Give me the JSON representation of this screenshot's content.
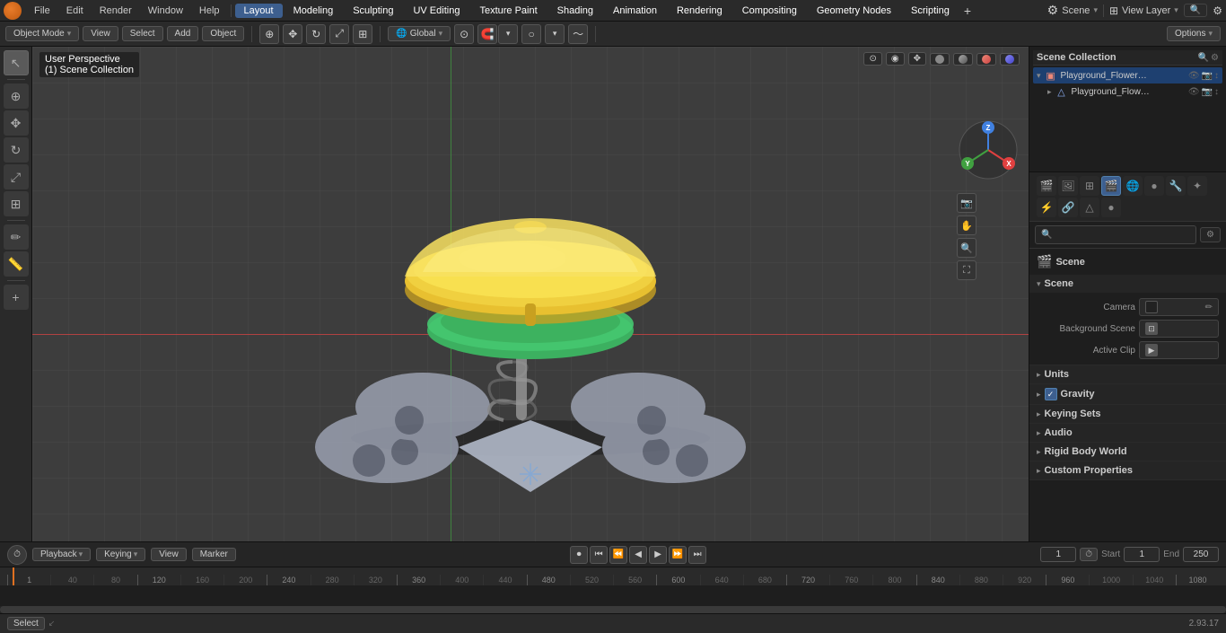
{
  "app": {
    "title": "Blender",
    "version": "2.93.17"
  },
  "top_menu": {
    "items": [
      "File",
      "Edit",
      "Render",
      "Window",
      "Help"
    ],
    "workspaces": [
      "Layout",
      "Modeling",
      "Sculpting",
      "UV Editing",
      "Texture Paint",
      "Shading",
      "Animation",
      "Rendering",
      "Compositing",
      "Geometry Nodes",
      "Scripting"
    ],
    "active_workspace": "Layout",
    "scene_label": "Scene",
    "view_layer_label": "View Layer"
  },
  "toolbar": {
    "mode_label": "Object Mode",
    "view_label": "View",
    "select_label": "Select",
    "add_label": "Add",
    "object_label": "Object",
    "global_label": "Global",
    "options_label": "Options"
  },
  "outliner": {
    "title": "Scene Collection",
    "items": [
      {
        "name": "Playground_Flower_Springer...",
        "indent": 0,
        "expanded": true
      },
      {
        "name": "Playground_Flower_Sprir",
        "indent": 1,
        "expanded": false
      }
    ]
  },
  "properties": {
    "current_tab": "scene",
    "tabs": [
      "render",
      "output",
      "view_layer",
      "scene",
      "world",
      "object",
      "modifier",
      "particles",
      "physics",
      "constraints",
      "object_data",
      "material",
      "texture"
    ],
    "search_placeholder": "",
    "scene_title": "Scene",
    "sections": {
      "scene": {
        "title": "Scene",
        "camera_label": "Camera",
        "camera_value": "",
        "background_scene_label": "Background Scene",
        "active_clip_label": "Active Clip",
        "active_clip_value": ""
      },
      "units": {
        "title": "Units",
        "expanded": false
      },
      "gravity": {
        "title": "Gravity",
        "expanded": false,
        "enabled": true
      },
      "keying_sets": {
        "title": "Keying Sets",
        "expanded": false
      },
      "audio": {
        "title": "Audio",
        "expanded": false
      },
      "rigid_body_world": {
        "title": "Rigid Body World",
        "expanded": false
      },
      "custom_properties": {
        "title": "Custom Properties",
        "expanded": false
      }
    }
  },
  "viewport": {
    "perspective": "User Perspective",
    "collection": "(1) Scene Collection"
  },
  "timeline": {
    "playback_label": "Playback",
    "keying_label": "Keying",
    "view_label": "View",
    "marker_label": "Marker",
    "current_frame": "1",
    "start_label": "Start",
    "start_value": "1",
    "end_label": "End",
    "end_value": "250",
    "ruler_marks": [
      "1",
      "40",
      "80",
      "120",
      "160",
      "200",
      "240",
      "280",
      "320",
      "360",
      "400",
      "440",
      "480",
      "520",
      "560",
      "600",
      "640",
      "680",
      "720",
      "760",
      "800",
      "840",
      "880",
      "920",
      "960",
      "1000",
      "1040",
      "1080"
    ]
  },
  "status_bar": {
    "select_label": "Select",
    "version": "2.93.17"
  },
  "axes": {
    "x_color": "#e04040",
    "y_color": "#80c040",
    "z_color": "#4080e0"
  }
}
